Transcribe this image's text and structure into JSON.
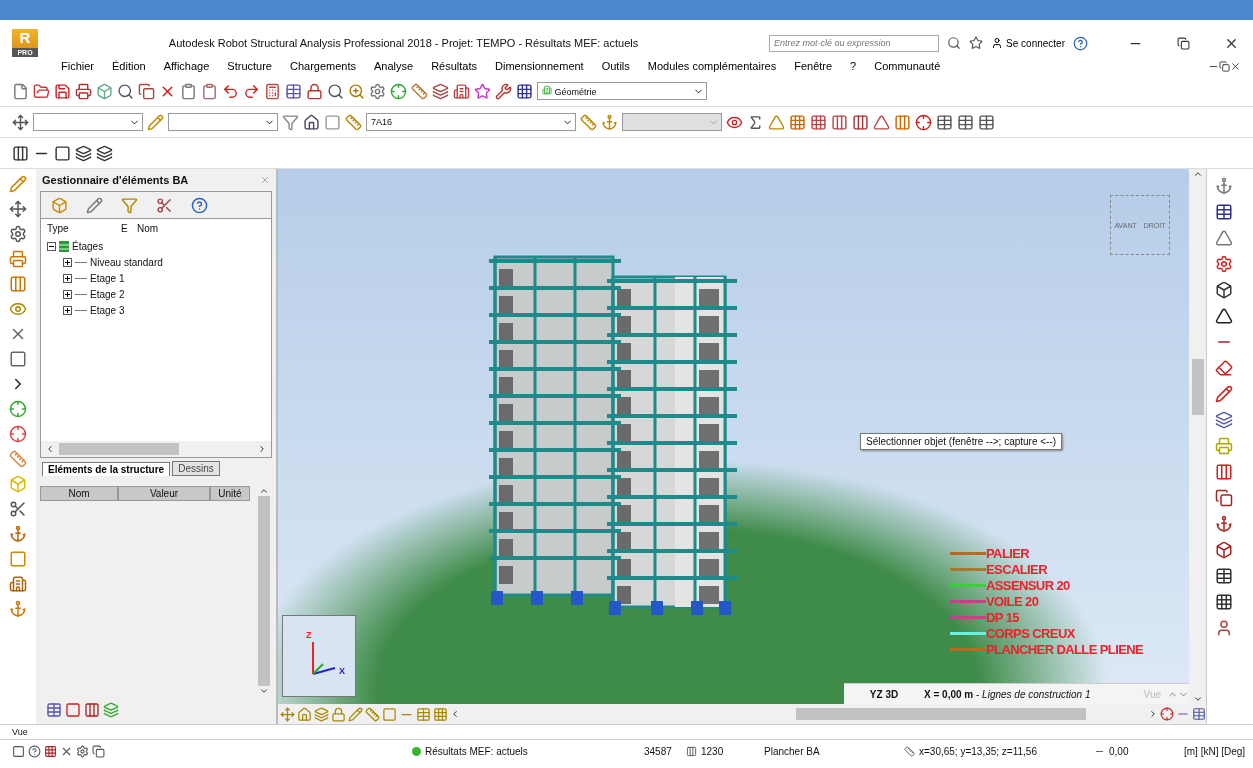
{
  "window": {
    "logo": {
      "letter": "R",
      "caption": "PRO"
    },
    "title": "Autodesk Robot Structural Analysis Professional 2018 - Projet: TEMPO - Résultats MEF: actuels",
    "search_placeholder": "Entrez mot-clé ou expression",
    "sign_in": "Se connecter"
  },
  "menu": [
    "Fichier",
    "Édition",
    "Affichage",
    "Structure",
    "Chargements",
    "Analyse",
    "Résultats",
    "Dimensionnement",
    "Outils",
    "Modules complémentaires",
    "Fenêtre",
    "?",
    "Communauté"
  ],
  "toolbar": {
    "view_combo": "Géométrie",
    "section_combo": "7A16"
  },
  "panel": {
    "title": "Gestionnaire d'éléments BA",
    "tree_columns": [
      "Type",
      "E",
      "Nom"
    ],
    "tree": [
      {
        "label": "Étages",
        "expanded": true,
        "children": [
          {
            "label": "Niveau standard",
            "expanded": false
          },
          {
            "label": "Etage 1",
            "expanded": false
          },
          {
            "label": "Etage 2",
            "expanded": false
          },
          {
            "label": "Etage 3",
            "expanded": false
          }
        ]
      }
    ],
    "tabs": [
      {
        "label": "Eléments de la structure",
        "selected": true
      },
      {
        "label": "Dessins",
        "selected": false
      }
    ],
    "property_columns": [
      "Nom",
      "Valeur",
      "Unité"
    ]
  },
  "viewport": {
    "view_cube": [
      "AVANT",
      "DROIT"
    ],
    "tooltip": "Sélectionner objet (fenêtre -->; capture <--)",
    "legend": [
      {
        "label": "PALIER",
        "color": "#b86a24"
      },
      {
        "label": "ESCALIER",
        "color": "#a8782c"
      },
      {
        "label": "ASSENSUR 20",
        "color": "#3ccc3c"
      },
      {
        "label": "VOILE 20",
        "color": "#c8408a"
      },
      {
        "label": "DP 15",
        "color": "#c8408a"
      },
      {
        "label": "CORPS CREUX",
        "color": "#6ef0e0"
      },
      {
        "label": "PLANCHER DALLE PLIENE",
        "color": "#b86a24"
      }
    ],
    "axes": [
      "Z",
      "X"
    ],
    "view_name": "YZ 3D",
    "view_position": "**X = 0,00 m** - *Lignes de construction 1*",
    "view_button": {
      "label": "Vue",
      "disabled": true
    }
  },
  "command_line": "Vue",
  "status_bar": {
    "results": "Résultats MEF: actuels",
    "nodes": "34587",
    "bars": "1230",
    "section": "Plancher BA",
    "coordinates": "x=30,65; y=13,35; z=11,56",
    "value": "0,00",
    "units": "[m] [kN] [Deg]"
  }
}
